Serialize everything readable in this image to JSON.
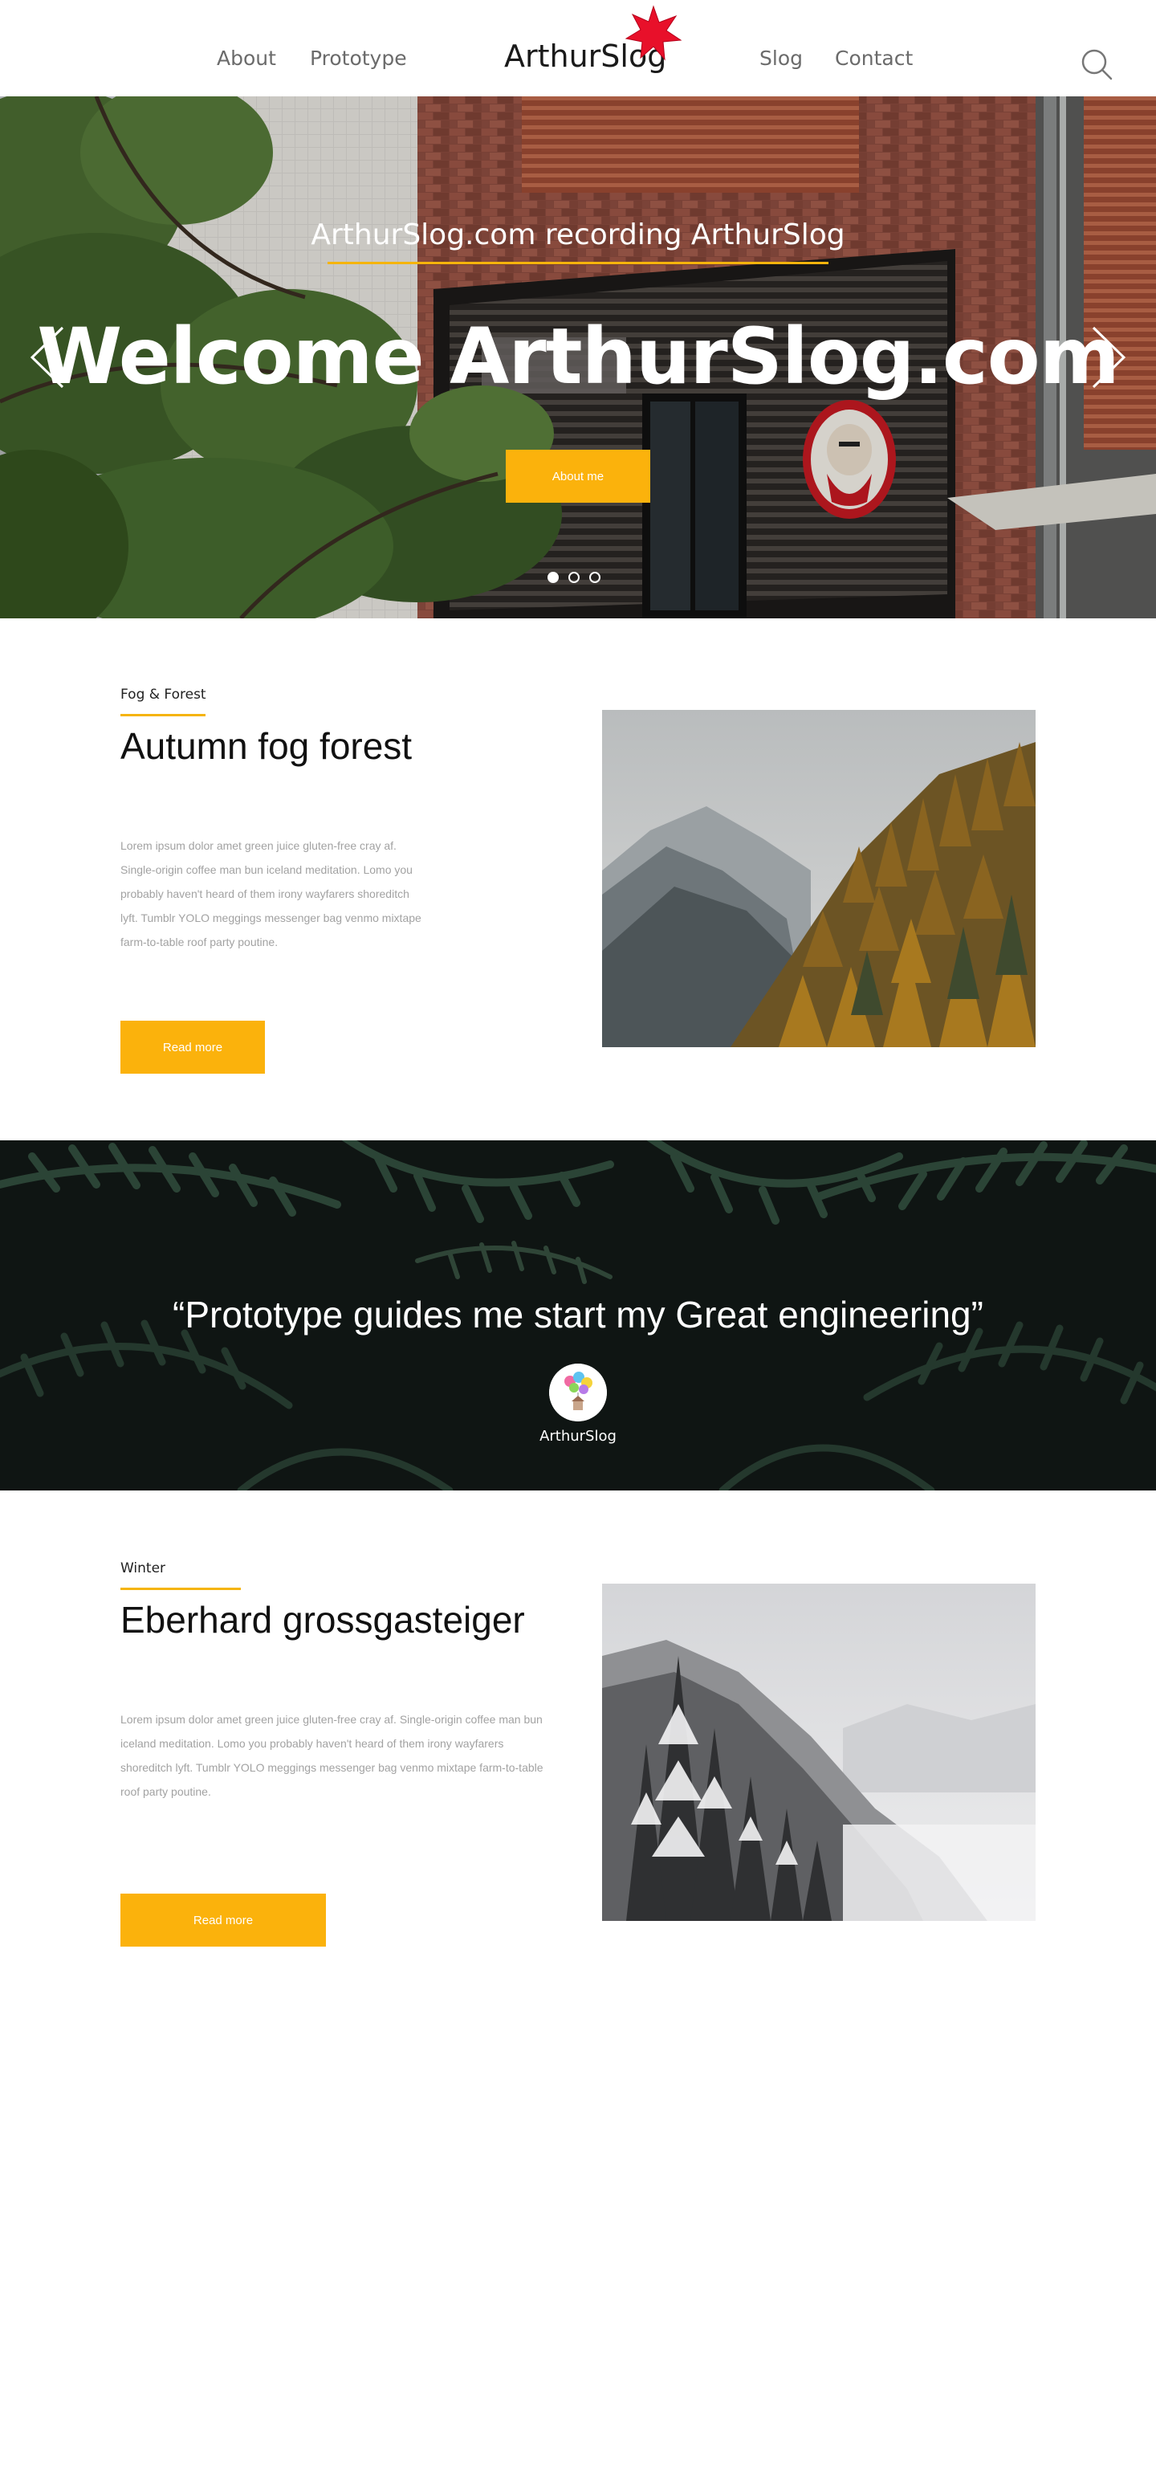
{
  "nav": {
    "left_links": [
      "About",
      "Prototype"
    ],
    "logo": "ArthurSlog",
    "right_links": [
      "Slog",
      "Contact"
    ],
    "search_icon": "search-icon"
  },
  "hero": {
    "subtitle": "ArthurSlog.com recording ArthurSlog",
    "title": "Welcome ArthurSlog.com",
    "button_label": "About me",
    "slide_count": 3,
    "active_slide": 1
  },
  "articles": [
    {
      "category": "Fog & Forest",
      "title": "Autumn fog forest",
      "body": "Lorem ipsum dolor amet green juice gluten-free cray af. Single-origin coffee man bun iceland meditation. Lomo you probably haven't heard of them irony wayfarers shoreditch lyft. Tumblr YOLO meggings messenger bag venmo mixtape farm-to-table roof party poutine.",
      "button_label": "Read more"
    },
    {
      "category": "Winter",
      "title": "Eberhard grossgasteiger",
      "body": "Lorem ipsum dolor amet green juice gluten-free cray af. Single-origin coffee man bun iceland meditation. Lomo you probably haven't heard of them irony wayfarers shoreditch lyft. Tumblr YOLO meggings messenger bag venmo mixtape farm-to-table roof party poutine.",
      "button_label": "Read more"
    }
  ],
  "quote": {
    "text": "“Prototype guides me start my Great engineering”",
    "author": "ArthurSlog"
  },
  "colors": {
    "accent": "#fbb20c",
    "underline": "#f5b40c",
    "body_text": "#a2a2a2",
    "nav_text": "#6b6b6b"
  }
}
